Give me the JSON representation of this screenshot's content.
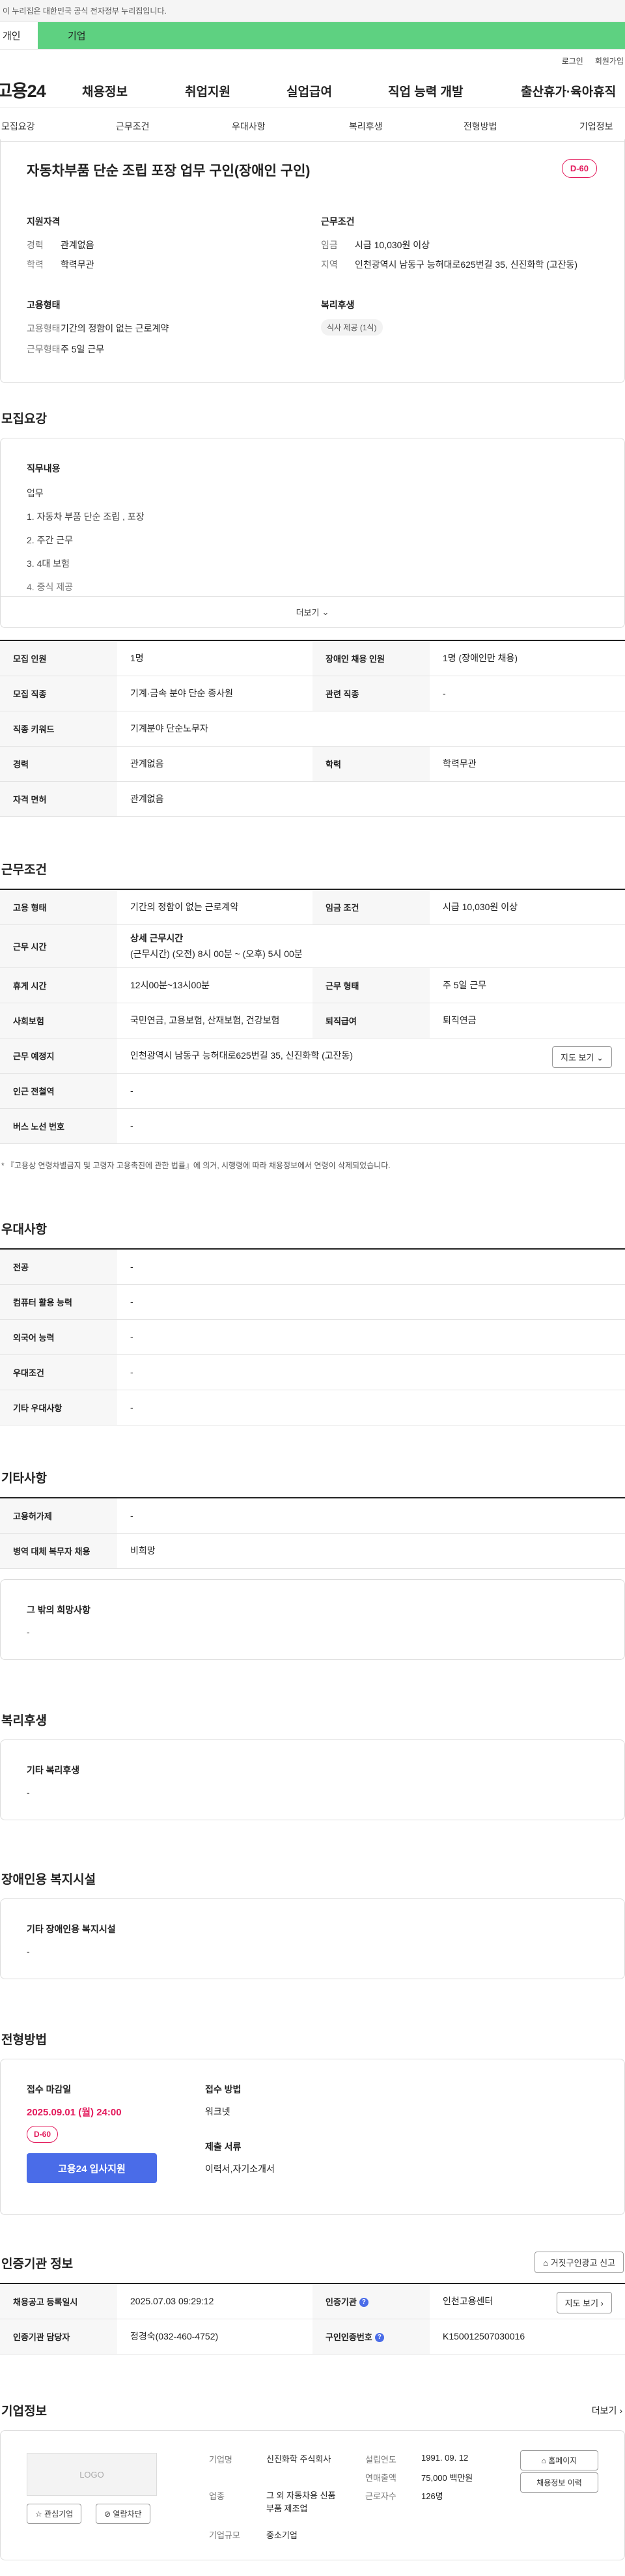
{
  "gov_banner": "이 누리집은 대한민국 공식 전자정부 누리집입니다.",
  "tabs": {
    "individual": "개인",
    "corporate": "기업"
  },
  "util": {
    "login": "로그인",
    "join": "회원가입"
  },
  "logo": "고용24",
  "gnb": [
    "채용정보",
    "취업지원",
    "실업급여",
    "직업 능력 개발",
    "출산휴가·육아휴직"
  ],
  "subnav": [
    "모집요강",
    "근무조건",
    "우대사항",
    "복리후생",
    "전형방법",
    "기업정보"
  ],
  "job": {
    "title": "자동차부품 단순 조립 포장 업무 구인(장애인 구인)",
    "dday": "D-60",
    "qual_h": "지원자격",
    "cond_h": "근무조건",
    "exp_k": "경력",
    "exp_v": "관계없음",
    "edu_k": "학력",
    "edu_v": "학력무관",
    "wage_k": "임금",
    "wage_v": "시급 10,030원 이상",
    "area_k": "지역",
    "area_v": "인천광역시 남동구 능허대로625번길 35, 신진화학 (고잔동)",
    "emp_h": "고용형태",
    "welfare_h": "복리후생",
    "emptype_k": "고용형태",
    "emptype_v": "기간의 정함이 없는 근로계약",
    "worktype_k": "근무형태",
    "worktype_v": "주 5일 근무",
    "meal": "식사 제공 (1식)"
  },
  "recruit": {
    "h": "모집요강",
    "duty_h": "직무내용",
    "duty": [
      "업무",
      "1. 자동차 부품 단순 조립 , 포장",
      "2. 주간 근무",
      "3. 4대 보험",
      "4. 중식 제공"
    ],
    "more": "더보기",
    "rows": {
      "r1": [
        "모집 인원",
        "1명",
        "장애인 채용 인원",
        "1명 (장애인만 채용)"
      ],
      "r2": [
        "모집 직종",
        "기계·금속 분야 단순 종사원",
        "관련 직종",
        "-"
      ],
      "r3": [
        "직종 키워드",
        "기계분야 단순노무자"
      ],
      "r4": [
        "경력",
        "관계없음",
        "학력",
        "학력무관"
      ],
      "r5": [
        "자격 면허",
        "관계없음"
      ]
    }
  },
  "work": {
    "h": "근무조건",
    "r1": [
      "고용 형태",
      "기간의 정함이 없는 근로계약",
      "임금 조건",
      "시급 10,030원 이상"
    ],
    "r2_k": "근무 시간",
    "r2_h": "상세 근무시간",
    "r2_v": "(근무시간) (오전) 8시 00분 ~ (오후) 5시 00분",
    "r3": [
      "휴게 시간",
      "12시00분~13시00분",
      "근무 형태",
      "주 5일 근무"
    ],
    "r4": [
      "사회보험",
      "국민연금, 고용보험, 산재보험, 건강보험",
      "퇴직급여",
      "퇴직연금"
    ],
    "r5_k": "근무 예정지",
    "r5_v": "인천광역시 남동구 능허대로625번길 35, 신진화학 (고잔동)",
    "map": "지도 보기",
    "r6": [
      "인근 전철역",
      "-"
    ],
    "r7": [
      "버스 노선 번호",
      "-"
    ],
    "note": "* 『고용상 연령차별금지 및 고령자 고용촉진에 관한 법률』에 의거, 시행령에 따라 채용정보에서 연령이 삭제되었습니다."
  },
  "pref": {
    "h": "우대사항",
    "rows": [
      [
        "전공",
        "-"
      ],
      [
        "컴퓨터 활용 능력",
        "-"
      ],
      [
        "외국어 능력",
        "-"
      ],
      [
        "우대조건",
        "-"
      ],
      [
        "기타 우대사항",
        "-"
      ]
    ]
  },
  "etc": {
    "h": "기타사항",
    "rows": [
      [
        "고용허가제",
        "-"
      ],
      [
        "병역 대체 복무자 채용",
        "비희망"
      ]
    ],
    "box_h": "그 밖의 희망사항",
    "box_v": "-"
  },
  "welfare": {
    "h": "복리후생",
    "box_h": "기타 복리후생",
    "box_v": "-"
  },
  "facility": {
    "h": "장애인용 복지시설",
    "box_h": "기타 장애인용 복지시설",
    "box_v": "-"
  },
  "select": {
    "h": "전형방법",
    "deadline_h": "접수 마감일",
    "deadline_v": "2025.09.01 (월) 24:00",
    "dday": "D-60",
    "apply": "고용24 입사지원",
    "method_h": "접수 방법",
    "method_v": "워크넷",
    "docs_h": "제출 서류",
    "docs_v": "이력서,자기소개서"
  },
  "cert": {
    "h": "인증기관 정보",
    "report": "거짓구인광고 신고",
    "r1": [
      "채용공고 등록일시",
      "2025.07.03 09:29:12",
      "인증기관",
      "인천고용센터"
    ],
    "r2": [
      "인증기관 담당자",
      "정경숙(032-460-4752)",
      "구인인증번호",
      "K150012507030016"
    ],
    "map": "지도 보기"
  },
  "company": {
    "h": "기업정보",
    "more": "더보기",
    "logo": "LOGO",
    "fav": "관심기업",
    "block": "열람차단",
    "name_k": "기업명",
    "name_v": "신진화학 주식회사",
    "ind_k": "업종",
    "ind_v": "그 외 자동차용 신품 부품 제조업",
    "size_k": "기업규모",
    "size_v": "중소기업",
    "est_k": "설립연도",
    "est_v": "1991. 09. 12",
    "sales_k": "연매출액",
    "sales_v": "75,000 백만원",
    "emp_k": "근로자수",
    "emp_v": "126명",
    "home": "홈페이지",
    "hist": "채용정보 이력"
  }
}
